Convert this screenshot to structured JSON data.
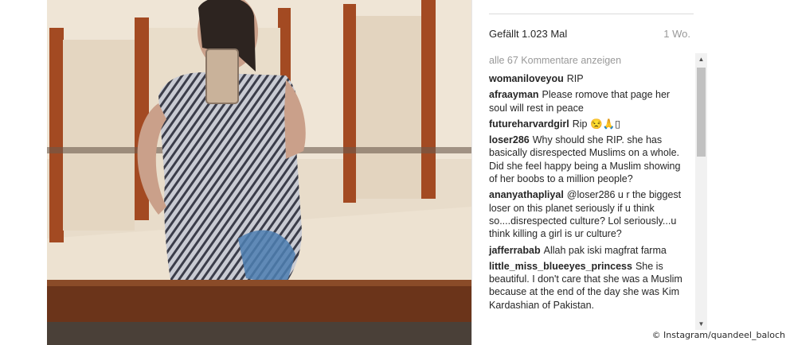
{
  "post": {
    "likes_text": "Gefällt 1.023 Mal",
    "time_ago": "1 Wo.",
    "show_all_comments": "alle 67 Kommentare anzeigen",
    "comments": [
      {
        "user": "womaniloveyou",
        "text": "RIP"
      },
      {
        "user": "afraayman",
        "text": "Please romove that page her soul will rest in peace"
      },
      {
        "user": "futureharvardgirl",
        "text": "Rip 😒🙏▯"
      },
      {
        "user": "loser286",
        "text": "Why should she RIP. she has basically disrespected Muslims on a whole. Did she feel happy being a Muslim showing of her boobs to a million people?"
      },
      {
        "user": "ananyathapliyal",
        "text": "@loser286 u r the biggest loser on this planet seriously if u think so....disrespected culture? Lol seriously...u think killing a girl is ur culture?"
      },
      {
        "user": "jafferrabab",
        "text": "Allah pak iski magfrat farma"
      },
      {
        "user": "little_miss_blueeyes_princess",
        "text": "She is beautiful. I don't care that she was a Muslim because at the end of the day she was Kim Kardashian of Pakistan."
      }
    ]
  },
  "photo": {
    "subject": "mirror-selfie-woman-striped-dress"
  },
  "credit": "© Instagram/quandeel_baloch",
  "scrollbar": {
    "position_fraction": 0.0
  }
}
